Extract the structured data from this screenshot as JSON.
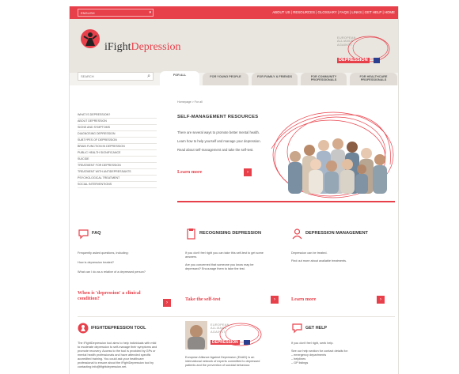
{
  "topbar": {
    "language": "ENGLISH",
    "links": "ABOUT US | RESOURCES | GLOSSARY | FAQS | LINKS | GET HELP | HOME"
  },
  "header": {
    "logo_i": "i",
    "logo_fight": "Fight",
    "logo_depression": "Depression",
    "partner_text": "EUROPEAN\nALLIANCE\nAGAINST",
    "partner_depression": "DEPRESSION"
  },
  "search": {
    "placeholder": "SEARCH"
  },
  "tabs": [
    "FOR ALL",
    "FOR YOUNG PEOPLE",
    "FOR FAMILY & FRIENDS",
    "FOR COMMUNITY PROFESSIONALS",
    "FOR HEALTHCARE PROFESSIONALS"
  ],
  "leftnav": [
    "WHAT IS DEPRESSION?",
    "ABOUT DEPRESSION",
    "SIGNS AND SYMPTOMS",
    "DIAGNOSING DEPRESSION",
    "SUBTYPES OF DEPRESSION",
    "BRAIN FUNCTION IN DEPRESSION",
    "PUBLIC HEALTH SIGNIFICANCE",
    "SUICIDE",
    "TREATMENT FOR DEPRESSION",
    "TREATMENT WITH ANTIDEPRESSANTS",
    "PSYCHOLOGICAL TREATMENT",
    "SOCIAL INTERVENTIONS"
  ],
  "main": {
    "breadcrumb": "Homepage > For all",
    "title": "SELF-MANAGEMENT RESOURCES",
    "p1": "There are several ways to promote better mental health.",
    "p2": "Learn how to help yourself and manage your depression.",
    "p3": "Read about self-management and take the self-test.",
    "learn_more": "Learn more"
  },
  "columns": [
    {
      "title": "FAQ",
      "icon": "speech-bubble-icon",
      "lines": [
        "Frequently asked questions, including:",
        "",
        "How is depression treated?",
        "",
        "What can I do as a relative of a depressed person?"
      ],
      "cta": "When is 'depression' a clinical condition?"
    },
    {
      "title": "RECOGNISING DEPRESSION",
      "icon": "clipboard-icon",
      "lines": [
        "If you don't feel right you can take this self-test to get some",
        "answers.",
        "",
        "Are you concerned that someone you know may be",
        "depressed? Encourage them to take the test."
      ],
      "cta": "Take the self-test"
    },
    {
      "title": "DEPRESSION MANAGEMENT",
      "icon": "person-icon",
      "lines": [
        "Depression can be treated.",
        "",
        "Find out more about available treatments."
      ],
      "cta": "Learn more"
    }
  ],
  "bottom": {
    "tool_title": "IFIGHTDEPRESSION TOOL",
    "tool_lines": [
      "The iFightDepression tool aims to help individuals with mild",
      "to moderate depression to self-manage their symptoms and",
      "promote recovery. Access to the tool is provided by GPs or",
      "mental health professionals and have attended specific",
      "accredited training. You could ask your healthcare",
      "professional to ensure about the iFightDepression tool by",
      "contacting info@ifightdepression.net."
    ],
    "eaad_lines": [
      "European Alliance Against Depression (EAAD) is an",
      "international network of experts committed to depressed",
      "patients and the prevention of suicidal behaviour."
    ],
    "help_title": "GET HELP",
    "help_lines": [
      "If you don't feel right, seek help.",
      "",
      "See our help section for contact details for:",
      "– emergency departments",
      "– helplines",
      "– GP listings"
    ]
  },
  "colors": {
    "accent": "#e8404a",
    "header_bg": "#e9e6e0",
    "tab_bg": "#e1ddd6"
  }
}
